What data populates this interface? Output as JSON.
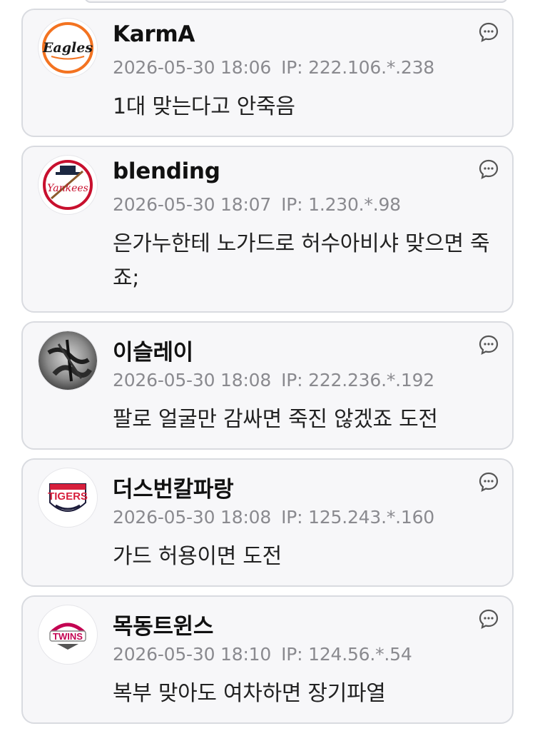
{
  "comments": [
    {
      "name": "KarmA",
      "date": "2026-05-30 18:06",
      "ip": "IP: 222.106.*.238",
      "text": "1대 맞는다고 안죽음",
      "avatar": {
        "icon": "eagles-logo-icon",
        "logo_text": "Eagles",
        "accent": "#f37321"
      }
    },
    {
      "name": "blending",
      "date": "2026-05-30 18:07",
      "ip": "IP: 1.230.*.98",
      "text": "은가누한테 노가드로 허수아비샤 맞으면 죽죠;",
      "avatar": {
        "icon": "yankees-logo-icon",
        "logo_text": "Yankees",
        "accent": "#c8102e"
      }
    },
    {
      "name": "이슬레이",
      "date": "2026-05-30 18:08",
      "ip": "IP: 222.236.*.192",
      "text": "팔로 얼굴만 감싸면 죽진 않겠죠 도전",
      "avatar": {
        "icon": "photo-avatar-icon",
        "accent": "#555555"
      }
    },
    {
      "name": "더스번칼파랑",
      "date": "2026-05-30 18:08",
      "ip": "IP: 125.243.*.160",
      "text": "가드 허용이면 도전",
      "avatar": {
        "icon": "tigers-logo-icon",
        "logo_text": "TIGERS",
        "accent": "#d71f3c"
      }
    },
    {
      "name": "목동트윈스",
      "date": "2026-05-30 18:10",
      "ip": "IP: 124.56.*.54",
      "text": "복부 맞아도 여차하면 장기파열",
      "avatar": {
        "icon": "twins-logo-icon",
        "logo_text": "TWINS",
        "accent": "#c30452"
      }
    }
  ],
  "colors": {
    "card_bg": "#f7f7f9",
    "card_border": "#d9dbe0",
    "meta_text": "#8a8a8f"
  }
}
